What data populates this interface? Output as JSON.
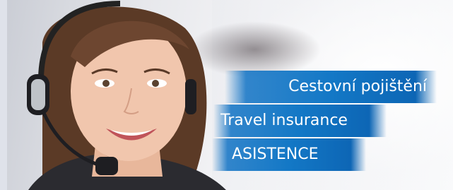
{
  "banner": {
    "line1": "Cestovní pojištění",
    "line2": "Travel insurance",
    "line3": "ASISTENCE"
  },
  "colors": {
    "accent_blue": "#1378c6",
    "text": "#ffffff"
  },
  "image": {
    "subject": "operator-with-headset"
  }
}
